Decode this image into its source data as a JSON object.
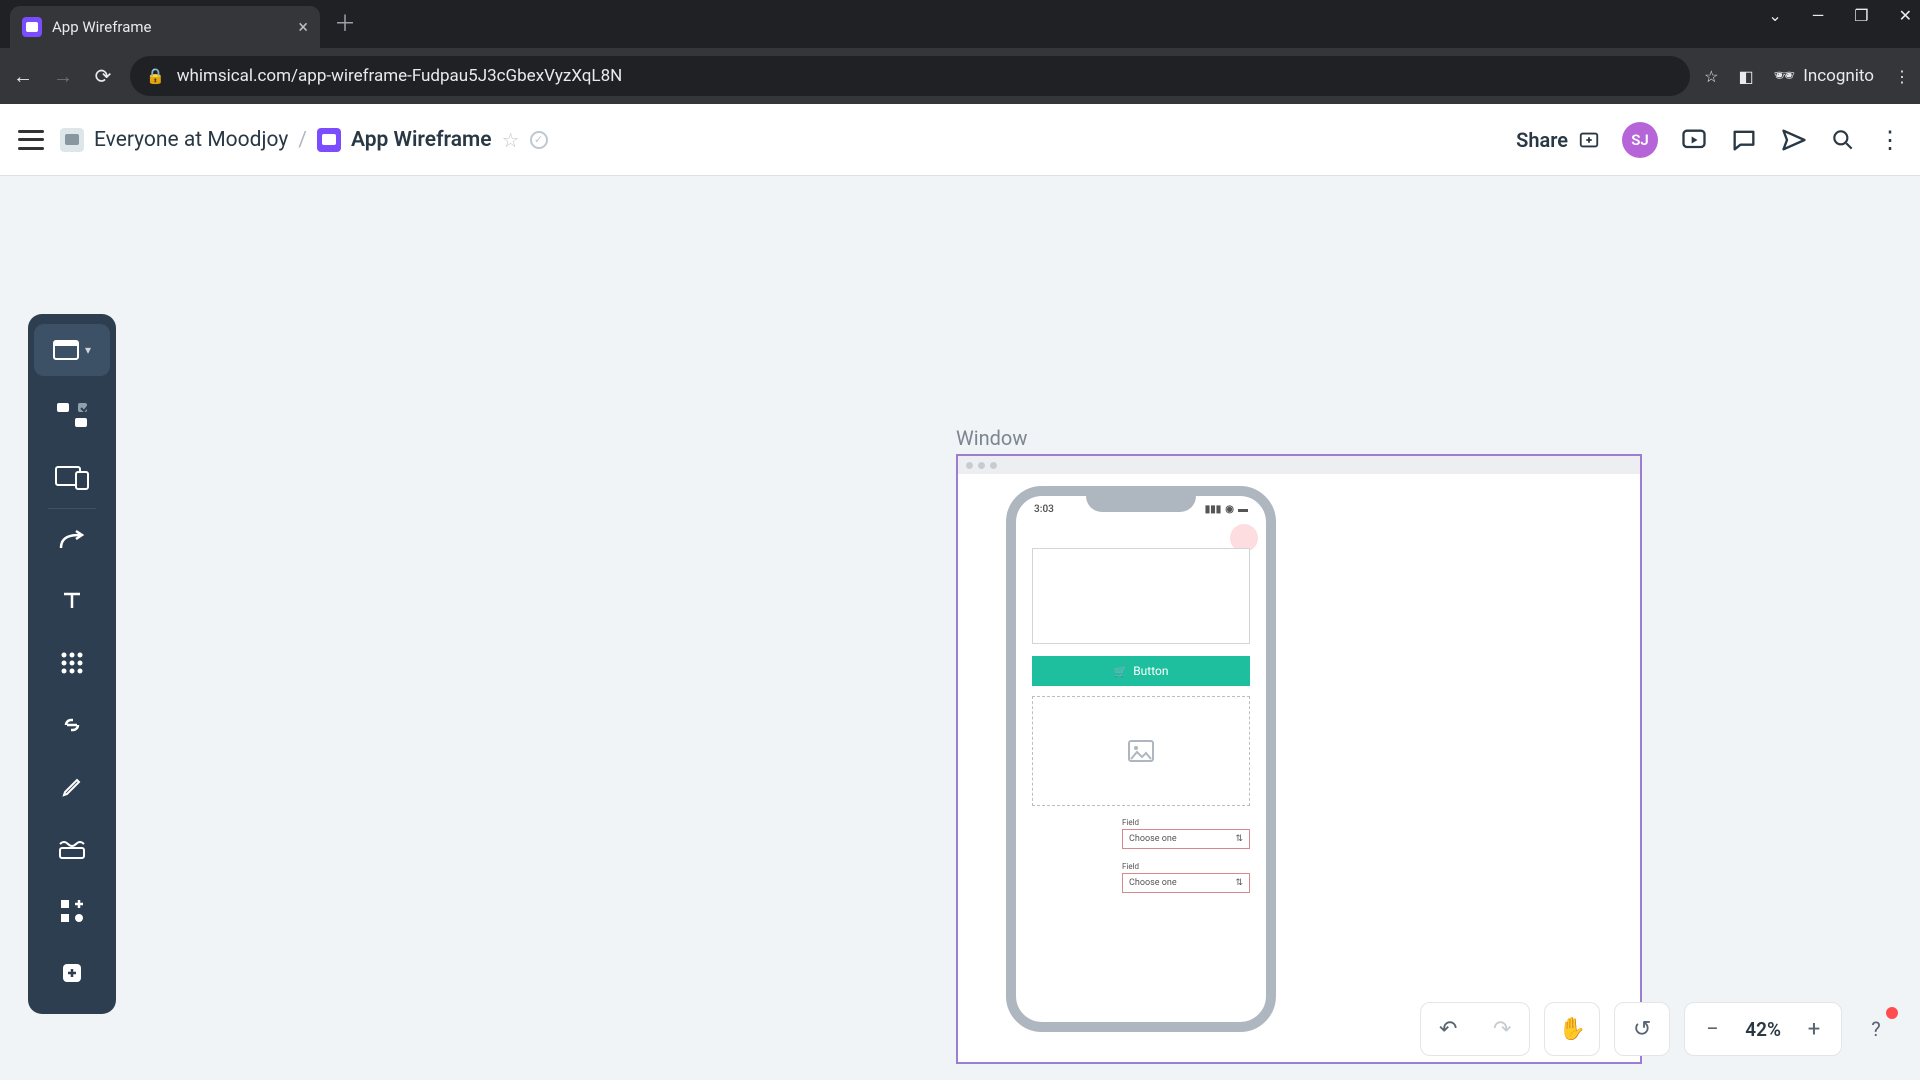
{
  "browser": {
    "tab_title": "App Wireframe",
    "url": "whimsical.com/app-wireframe-Fudpau5J3cGbexVyzXqL8N",
    "incognito_label": "Incognito"
  },
  "header": {
    "team": "Everyone at Moodjoy",
    "title": "App Wireframe",
    "share_label": "Share",
    "avatar_initials": "SJ"
  },
  "canvas": {
    "window_label": "Window",
    "phone": {
      "time": "3:03",
      "button_label": "Button",
      "fields": [
        {
          "label": "Field",
          "value": "Choose one"
        },
        {
          "label": "Field",
          "value": "Choose one"
        }
      ]
    }
  },
  "footer": {
    "zoom": "42%"
  }
}
